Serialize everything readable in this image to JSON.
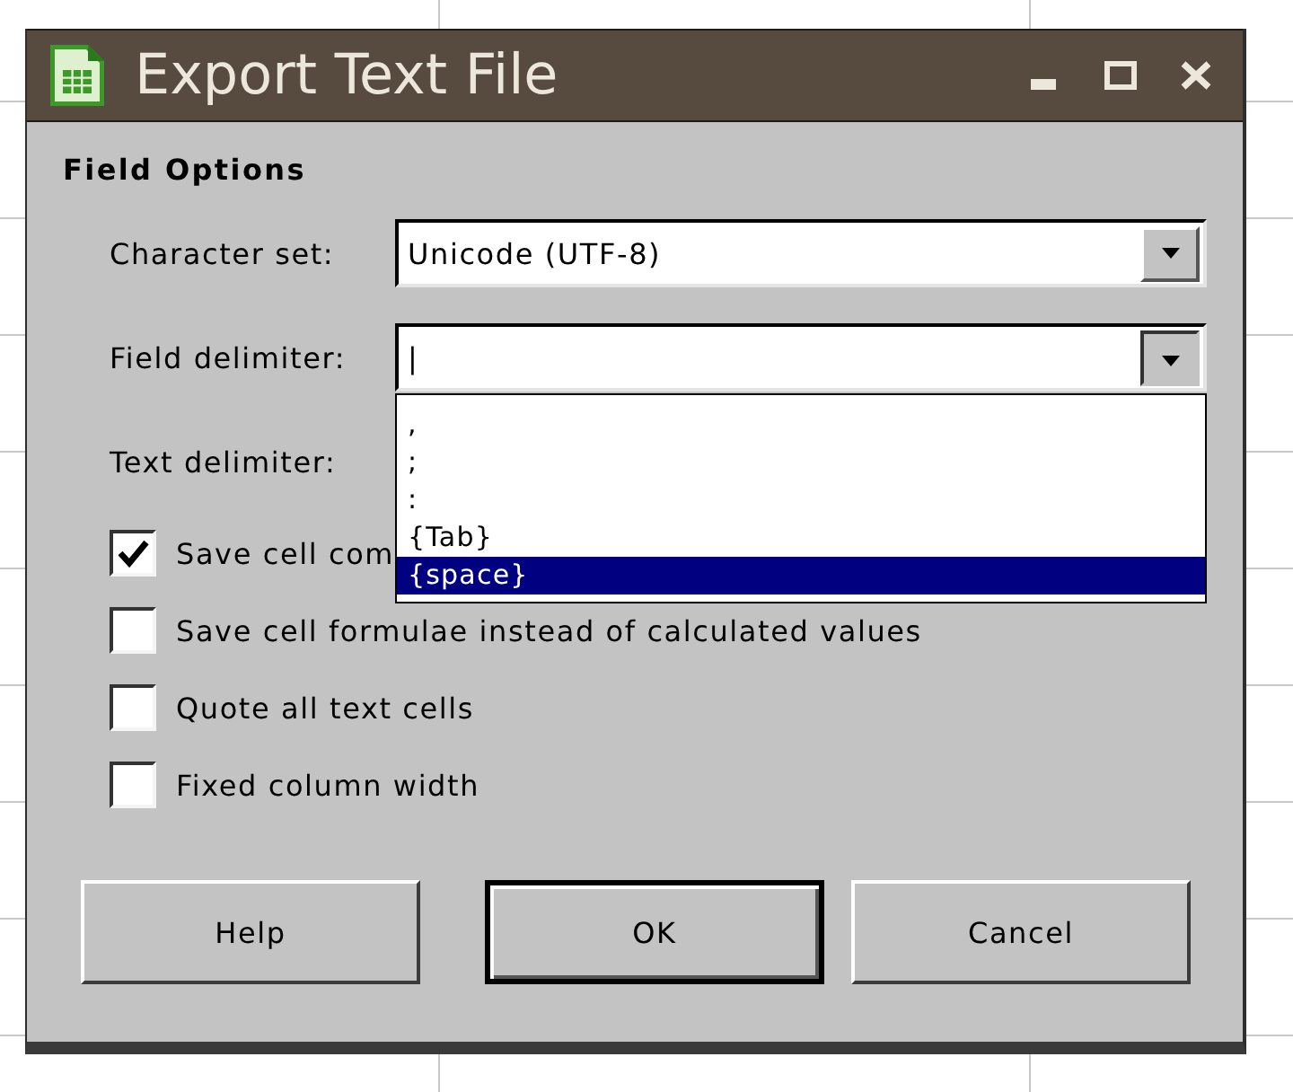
{
  "window": {
    "title": "Export Text File"
  },
  "section": {
    "title": "Field Options"
  },
  "fields": [
    {
      "label": "Character set:",
      "value": "Unicode (UTF-8)",
      "expanded": false
    },
    {
      "label": "Field delimiter:",
      "value": "|",
      "expanded": true,
      "options": [
        {
          "label": ",",
          "selected": false
        },
        {
          "label": ";",
          "selected": false
        },
        {
          "label": ":",
          "selected": false
        },
        {
          "label": "{Tab}",
          "selected": false
        },
        {
          "label": "{space}",
          "selected": true
        }
      ]
    },
    {
      "label": "Text delimiter:"
    }
  ],
  "checkboxes": [
    {
      "label": "Save cell com",
      "checked": true
    },
    {
      "label": "Save cell formulae instead of calculated values",
      "checked": false
    },
    {
      "label": "Quote all text cells",
      "checked": false
    },
    {
      "label": "Fixed column width",
      "checked": false
    }
  ],
  "buttons": [
    {
      "label": "Help",
      "default": false
    },
    {
      "label": "OK",
      "default": true
    },
    {
      "label": "Cancel",
      "default": false
    }
  ]
}
